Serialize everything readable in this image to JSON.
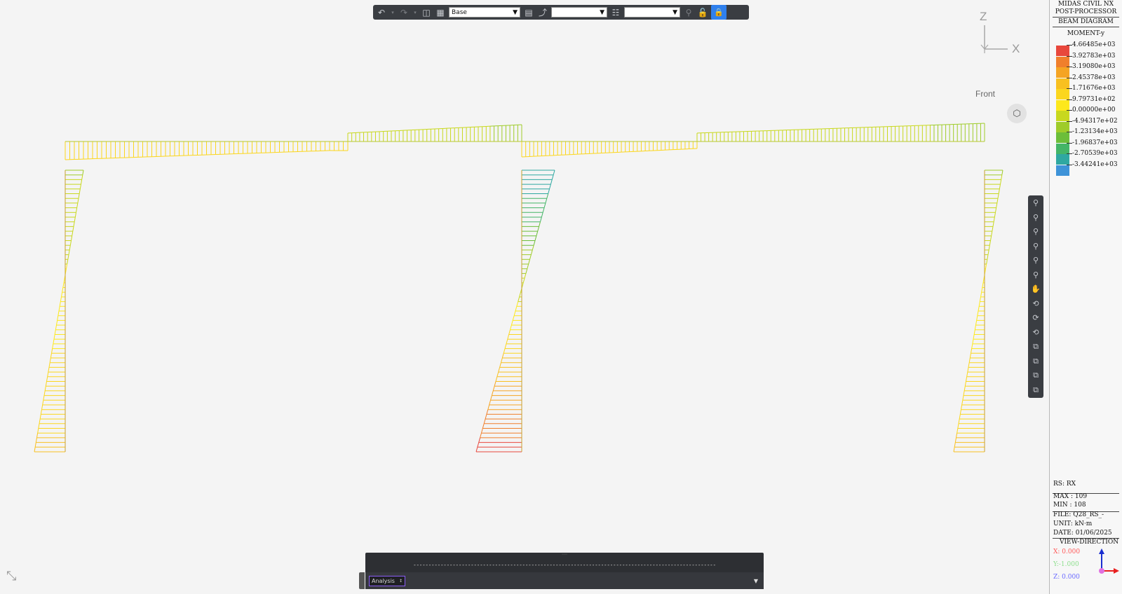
{
  "toolbar": {
    "undo_icon": "undo-icon",
    "redo_icon": "redo-icon",
    "base_select": "Base",
    "select2": "",
    "select3": ""
  },
  "viewcube": {
    "axis_z": "Z",
    "axis_x": "X",
    "view_label": "Front"
  },
  "legend_panel": {
    "title1": "MIDAS CIVIL NX",
    "title2": "POST-PROCESSOR",
    "diagram": "BEAM DIAGRAM",
    "component": "MOMENT-y",
    "entries": [
      {
        "label": "4.66485e+03",
        "color": "#e8473c"
      },
      {
        "label": "3.92783e+03",
        "color": "#f07f2c"
      },
      {
        "label": "3.19080e+03",
        "color": "#f5a423"
      },
      {
        "label": "2.45378e+03",
        "color": "#f8c020"
      },
      {
        "label": "1.71676e+03",
        "color": "#fbd61e"
      },
      {
        "label": "9.79731e+02",
        "color": "#fde81c"
      },
      {
        "label": "0.00000e+00",
        "color": "#c8d81e"
      },
      {
        "label": "-4.94317e+02",
        "color": "#9fcc2a"
      },
      {
        "label": "-1.23134e+03",
        "color": "#6cbe3a"
      },
      {
        "label": "-1.96837e+03",
        "color": "#44b567"
      },
      {
        "label": "-2.70539e+03",
        "color": "#2fa8a1"
      },
      {
        "label": "-3.44241e+03",
        "color": "#3e93d8"
      }
    ],
    "rs": "RS: RX",
    "max": "MAX : 109",
    "min": "MIN : 108",
    "file": "FILE: Q28_RS_-",
    "unit": "UNIT: kN·m",
    "date": "DATE: 01/06/2025",
    "view_direction": "VIEW-DIRECTION",
    "vx": "X: 0.000",
    "vy": "Y:-1.000",
    "vz": "Z: 0.000",
    "vx_color": "#ff5a5a",
    "vy_color": "#8ee08e",
    "vz_color": "#6b6bff"
  },
  "console": {
    "separator": "----------------------------------------------------------------------------------------------------",
    "mode_select": "Analysis"
  },
  "sidebar_tools": [
    "zoom-fit-icon",
    "zoom-window-icon",
    "zoom-in-icon",
    "zoom-out-icon",
    "zoom-all-icon",
    "zoom-previous-icon",
    "pan-hand-icon",
    "rotate-icon",
    "rotate-left-icon",
    "rotate-right-icon",
    "view-iso-icon",
    "view-front-icon",
    "view-side-icon",
    "view-top-icon"
  ]
}
